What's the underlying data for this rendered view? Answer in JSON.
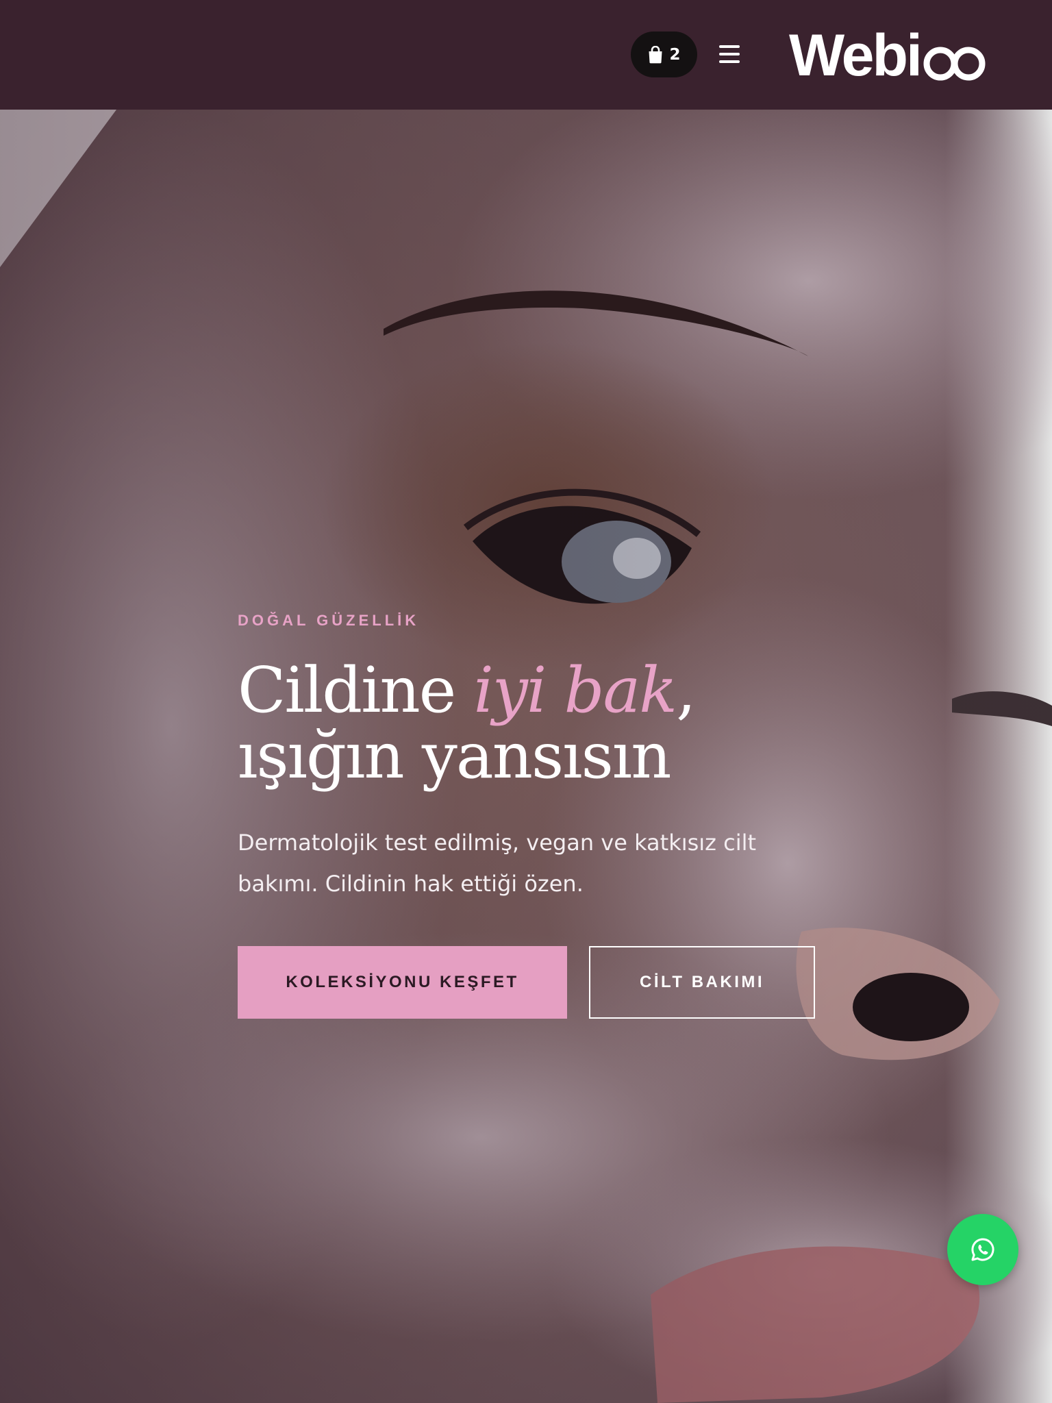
{
  "header": {
    "cart_count": "2",
    "logo_text": "Webioo",
    "cart_icon": "shopping-bag-icon",
    "menu_icon": "hamburger-menu-icon"
  },
  "hero": {
    "eyebrow": "DOĞAL GÜZELLİK",
    "headline_start": "Cildine ",
    "headline_accent": "iyi bak",
    "headline_comma": ",",
    "headline_line2": "ışığın yansısın",
    "lede": "Dermatolojik test edilmiş, vegan ve katkısız cilt bakımı. Cildinin hak ettiği özen.",
    "primary_cta": "KOLEKSİYONU KEŞFET",
    "secondary_cta": "CİLT BAKIMI",
    "background": "close-up photo of a face with a white facial mask"
  },
  "floating": {
    "whatsapp_icon": "whatsapp-icon"
  },
  "colors": {
    "header_bg": "#3a222e",
    "accent_pink": "#e8a3c7",
    "button_pink": "#e59fc2",
    "whatsapp_green": "#25d366",
    "cart_pill": "#141112"
  }
}
